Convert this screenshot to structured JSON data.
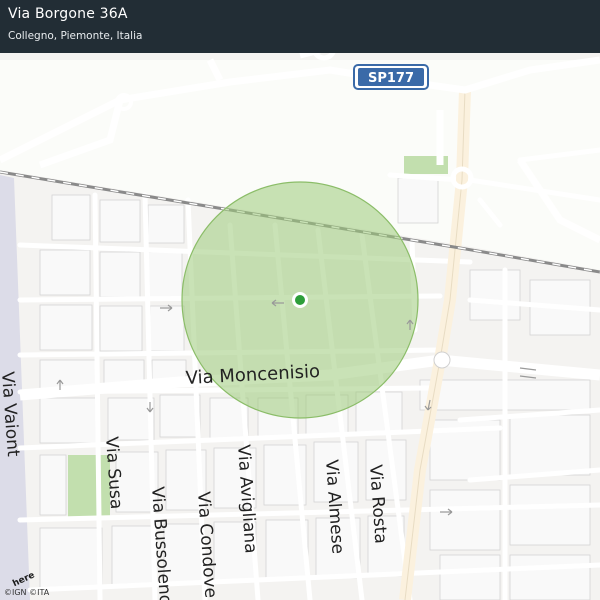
{
  "header": {
    "title": "Via Borgone 36A",
    "subtitle": "Collegno, Piemonte, Italia"
  },
  "map": {
    "road_shield": "SP177",
    "streets": {
      "moncenisio": "Via Moncenisio",
      "vaiont": "Via Vaiont",
      "susa": "Via Susa",
      "bussoleno": "Via Bussoleno",
      "condove": "Via Condove",
      "avigliana": "Via Avigliana",
      "almese": "Via Almese",
      "rosta": "Via Rosta"
    },
    "colors": {
      "accuracy_circle": "#9ccb7a",
      "location_dot": "#2e9e3a",
      "shield": "#3a6aa8",
      "header_bg": "#142028"
    },
    "logo": "here",
    "attribution": "©IGN ©ITA"
  }
}
